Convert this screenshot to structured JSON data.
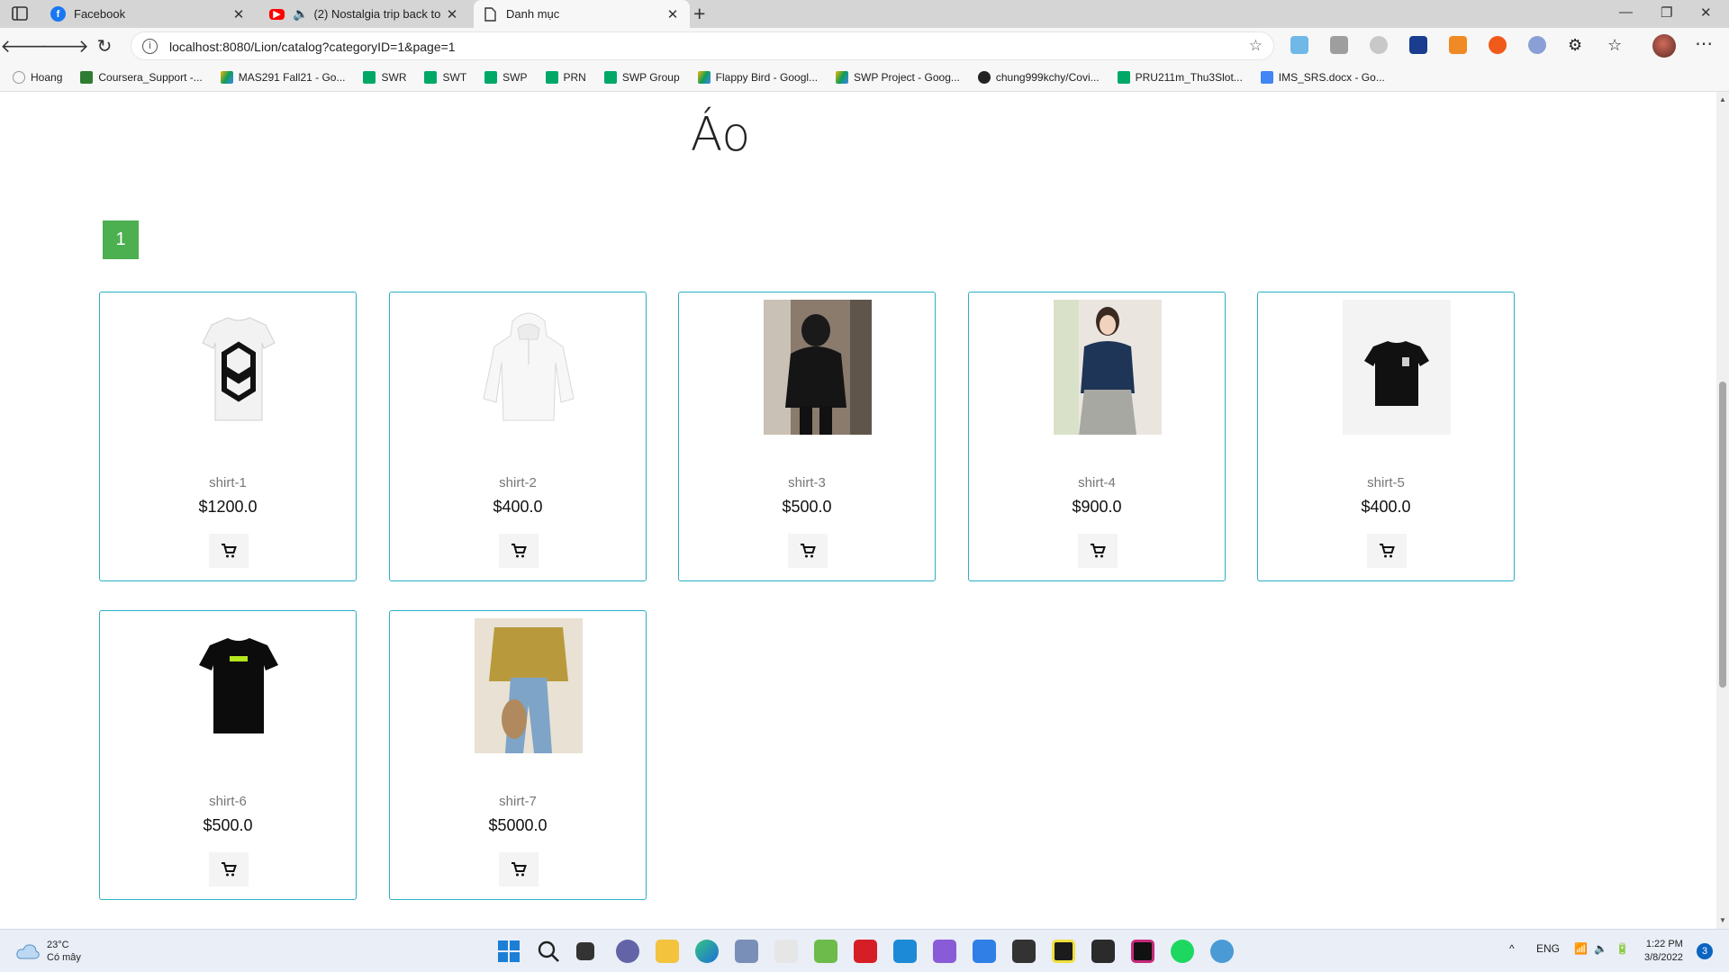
{
  "browser": {
    "tabs": [
      {
        "title": "Facebook",
        "icon": "facebook-icon"
      },
      {
        "title": "(2) Nostalgia trip back to ch",
        "icon": "youtube-icon"
      },
      {
        "title": "Danh mục",
        "icon": "page-icon"
      }
    ],
    "url": "localhost:8080/Lion/catalog?categoryID=1&page=1",
    "bookmarks": [
      "Hoang",
      "Coursera_Support -...",
      "MAS291 Fall21 - Go...",
      "SWR",
      "SWT",
      "SWP",
      "PRN",
      "SWP Group",
      "Flappy Bird - Googl...",
      "SWP Project - Goog...",
      "chung999kchy/Covi...",
      "PRU211m_Thu3Slot...",
      "IMS_SRS.docx - Go..."
    ]
  },
  "page": {
    "category_title": "Áo",
    "pagination": {
      "current": "1"
    },
    "products": [
      {
        "name": "shirt-1",
        "price": "$1200.0"
      },
      {
        "name": "shirt-2",
        "price": "$400.0"
      },
      {
        "name": "shirt-3",
        "price": "$500.0"
      },
      {
        "name": "shirt-4",
        "price": "$900.0"
      },
      {
        "name": "shirt-5",
        "price": "$400.0"
      },
      {
        "name": "shirt-6",
        "price": "$500.0"
      },
      {
        "name": "shirt-7",
        "price": "$5000.0"
      }
    ],
    "accent_color": "#2ab0c4",
    "pagination_color": "#4caf50"
  },
  "taskbar": {
    "weather_temp": "23°C",
    "weather_desc": "Có mây",
    "language": "ENG",
    "time": "1:22 PM",
    "date": "3/8/2022",
    "notifications": "3"
  }
}
